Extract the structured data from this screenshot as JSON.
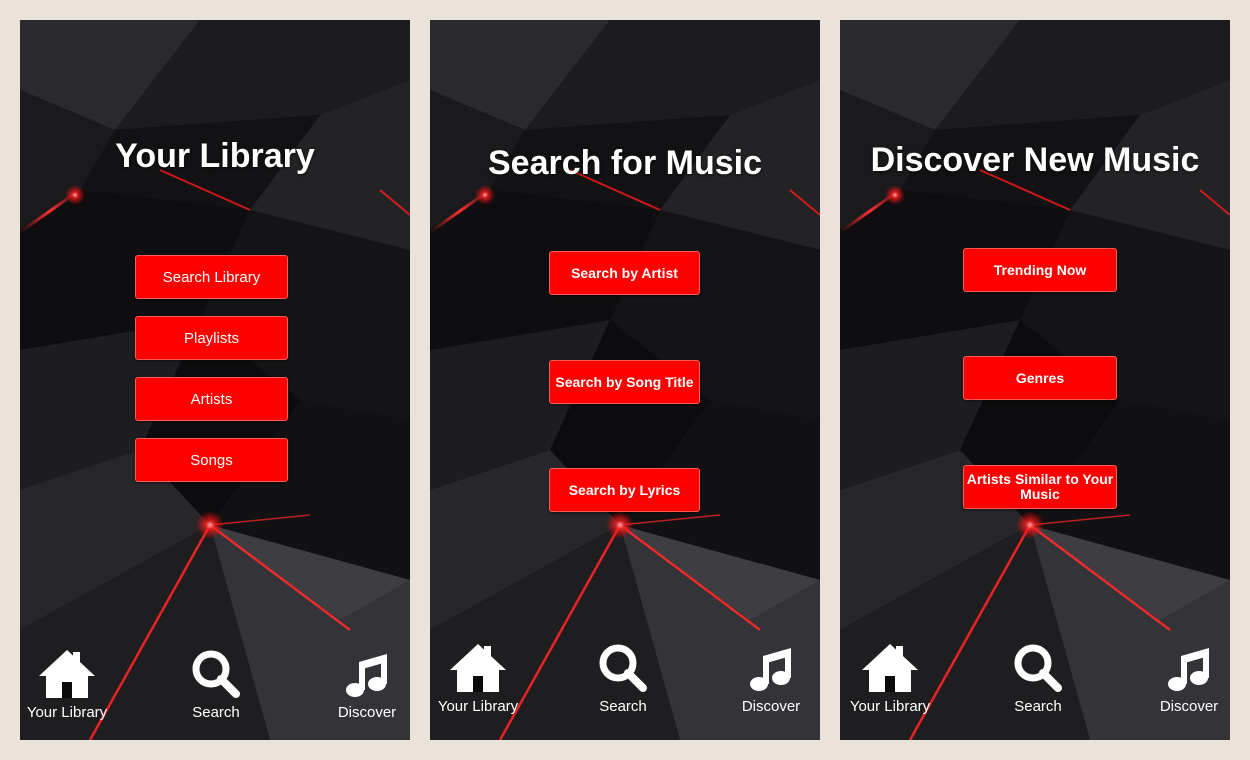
{
  "library": {
    "title": "Your Library",
    "buttons": [
      "Search Library",
      "Playlists",
      "Artists",
      "Songs"
    ]
  },
  "search": {
    "title": "Search for Music",
    "buttons": [
      "Search by Artist",
      "Search by Song Title",
      "Search by Lyrics"
    ]
  },
  "discover": {
    "title": "Discover New Music",
    "buttons": [
      "Trending Now",
      "Genres",
      "Artists Similar to Your Music"
    ]
  },
  "nav": {
    "home_label": "Your Library",
    "search_label": "Search",
    "discover_label": "Discover",
    "home_icon": "home-icon",
    "search_icon": "search-icon",
    "discover_icon": "music-note-icon"
  },
  "colors": {
    "page_background": "#ebe3da",
    "screen_background": "#0a0a0b",
    "button": "#ff0000",
    "accent_glow": "#ff2a2a",
    "text": "#ffffff"
  }
}
